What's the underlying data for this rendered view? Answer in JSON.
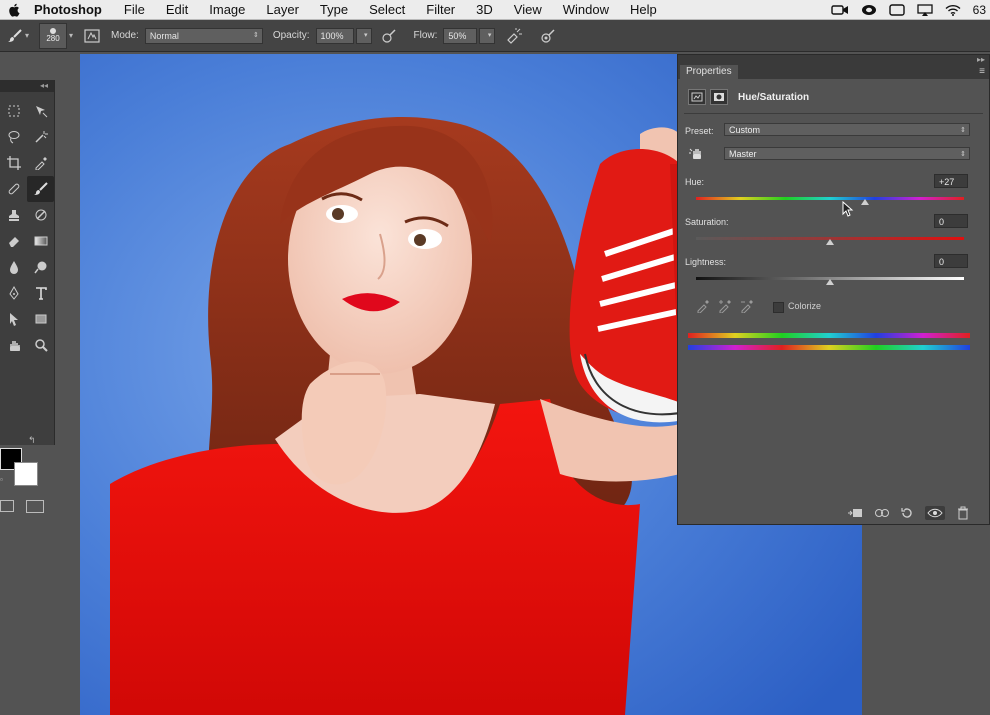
{
  "menubar": {
    "app": "Photoshop",
    "items": [
      "File",
      "Edit",
      "Image",
      "Layer",
      "Type",
      "Select",
      "Filter",
      "3D",
      "View",
      "Window",
      "Help"
    ],
    "battery": "63"
  },
  "options": {
    "brush_size": "280",
    "mode_label": "Mode:",
    "mode_value": "Normal",
    "opacity_label": "Opacity:",
    "opacity_value": "100%",
    "flow_label": "Flow:",
    "flow_value": "50%"
  },
  "properties": {
    "tab": "Properties",
    "adjustment_title": "Hue/Saturation",
    "preset_label": "Preset:",
    "preset_value": "Custom",
    "channel_value": "Master",
    "hue_label": "Hue:",
    "hue_value": "+27",
    "saturation_label": "Saturation:",
    "saturation_value": "0",
    "lightness_label": "Lightness:",
    "lightness_value": "0",
    "colorize_label": "Colorize",
    "colorize_checked": false,
    "slider_fractions": {
      "hue": 0.6,
      "saturation": 0.5,
      "lightness": 0.5
    }
  },
  "colors": {
    "foreground": "#000000",
    "background": "#ffffff",
    "canvas_backdrop": "#4b7fd8"
  },
  "icons": [
    "apple-logo-icon",
    "brush-icon",
    "toggle-brush-panel-icon",
    "pressure-opacity-icon",
    "airbrush-icon",
    "pressure-size-icon",
    "adjustment-layer-icon",
    "mask-icon",
    "targeted-adjustment-icon",
    "eyedropper-icon",
    "clip-to-layer-icon",
    "view-previous-icon",
    "reset-icon",
    "visibility-icon",
    "trash-icon"
  ]
}
